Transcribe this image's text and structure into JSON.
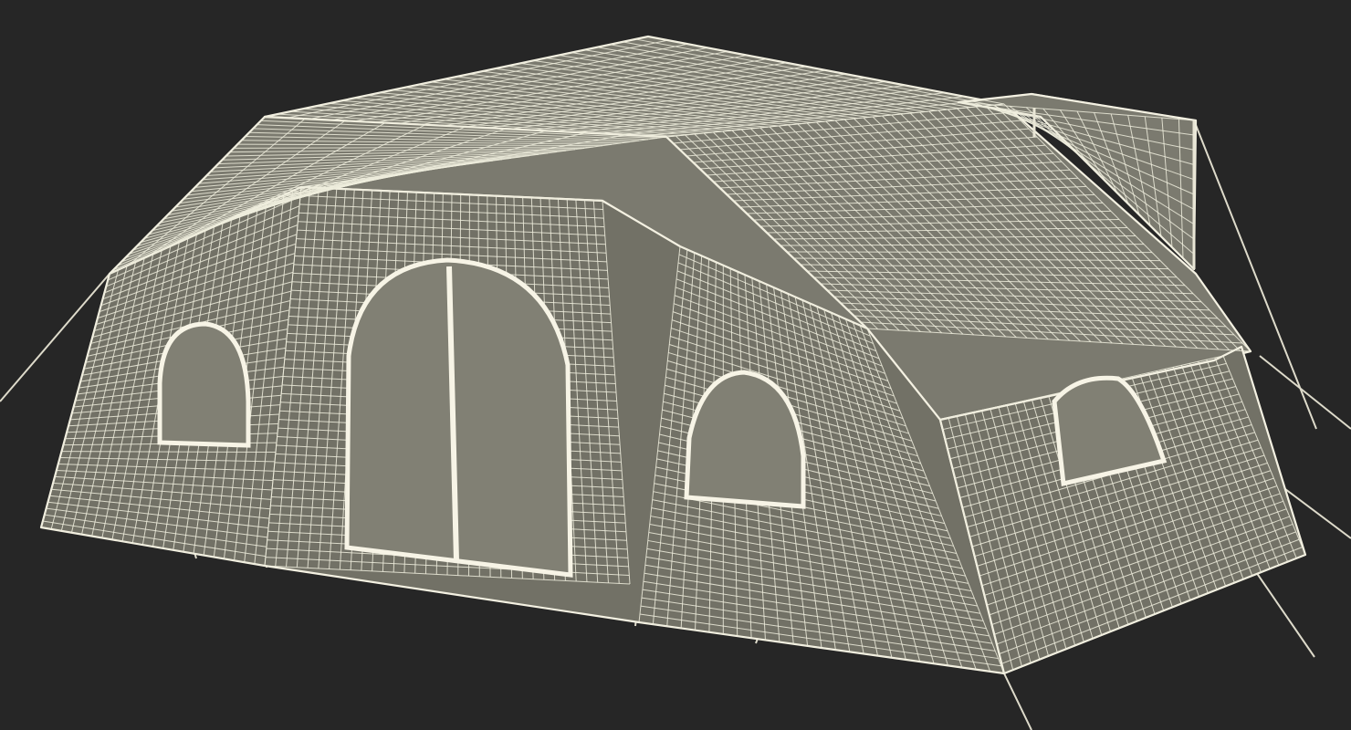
{
  "scene": {
    "subject": "wireframe-tent-render",
    "background_color": "#262626",
    "fabric_color": "#7b7a6f",
    "fabric_dark_color": "#6c6b61",
    "wire_color": "#f2efdf",
    "rope_color": "#e9e6d6"
  }
}
